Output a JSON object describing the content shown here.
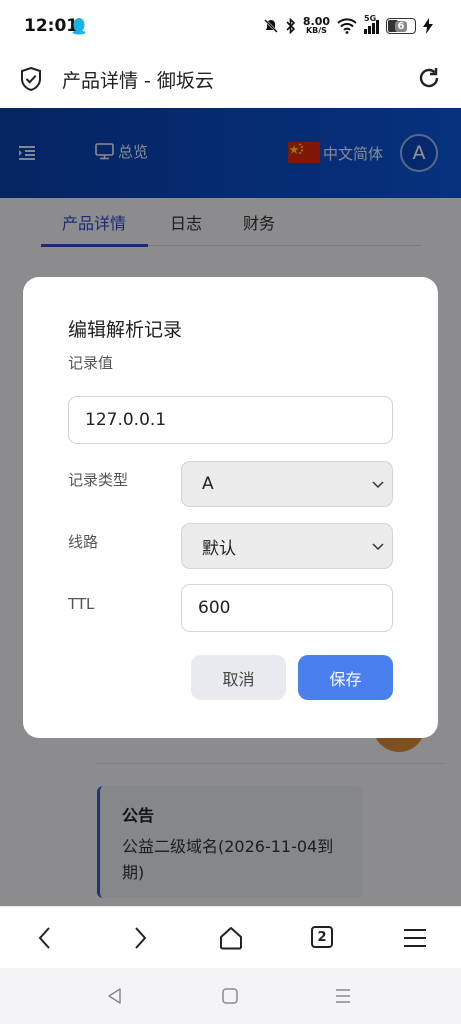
{
  "status_bar": {
    "time": "12:01",
    "net_speed_value": "8.00",
    "net_speed_unit": "KB/S",
    "signal_label": "5G",
    "battery_level": "6"
  },
  "browser": {
    "page_title": "产品详情 - 御坂云",
    "tab_count": "2"
  },
  "topnav": {
    "overview_label": "总览",
    "language_label": "中文简体",
    "avatar_letter": "A"
  },
  "tabs": [
    {
      "label": "产品详情",
      "active": true
    },
    {
      "label": "日志",
      "active": false
    },
    {
      "label": "财务",
      "active": false
    }
  ],
  "notice": {
    "title": "公告",
    "body": "公益二级域名(2026-11-04到期)"
  },
  "dialog": {
    "title": "编辑解析记录",
    "record_value_label": "记录值",
    "record_value": "127.0.0.1",
    "record_type_label": "记录类型",
    "record_type_value": "A",
    "line_label": "线路",
    "line_value": "默认",
    "ttl_label": "TTL",
    "ttl_value": "600",
    "cancel_label": "取消",
    "save_label": "保存"
  },
  "colors": {
    "nav_gradient_start": "#0a3ea8",
    "nav_gradient_end": "#0b56d8",
    "accent": "#2f49c5",
    "save_button": "#4a80ee"
  },
  "icons": {
    "shield": "shield-check-icon",
    "reload": "reload-icon",
    "menu": "menu-collapse-icon",
    "overview": "monitor-icon",
    "flag": "china-flag-icon",
    "back": "chevron-left-icon",
    "forward": "chevron-right-icon",
    "home": "home-icon",
    "menu_lines": "hamburger-icon"
  }
}
